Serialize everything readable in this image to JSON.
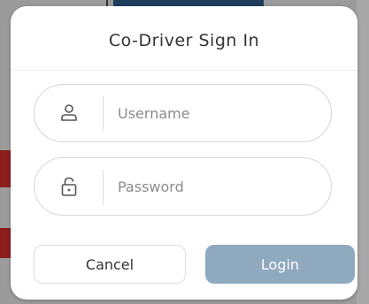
{
  "dialog": {
    "title": "Co-Driver Sign In",
    "username": {
      "icon": "user-icon",
      "placeholder": "Username",
      "value": ""
    },
    "password": {
      "icon": "lock-icon",
      "placeholder": "Password",
      "value": ""
    },
    "cancel_label": "Cancel",
    "login_label": "Login"
  },
  "colors": {
    "login_button": "#8fa9bf",
    "overlay": "#9b9b9b",
    "background_accent_red": "#8b1d1d",
    "background_accent_navy": "#1f3d5c"
  }
}
